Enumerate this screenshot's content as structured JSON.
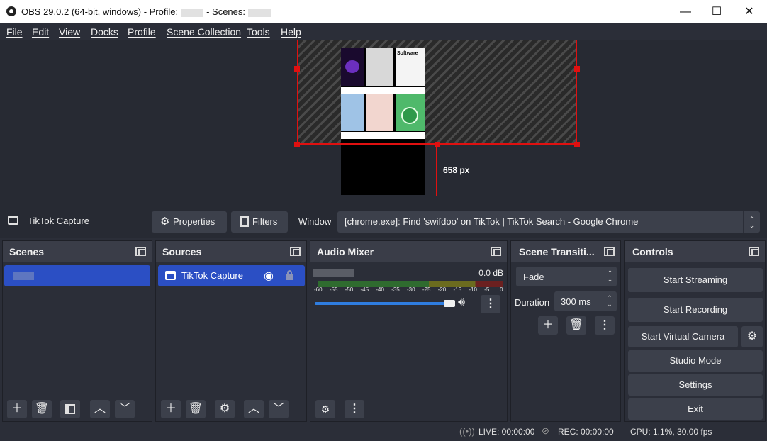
{
  "window": {
    "title_app": "OBS 29.0.2 (64-bit, windows) - Profile:",
    "title_scenes": "- Scenes:",
    "minimize": "—",
    "maximize": "☐",
    "close": "✕"
  },
  "menu": [
    "File",
    "Edit",
    "View",
    "Docks",
    "Profile",
    "Scene Collection",
    "Tools",
    "Help"
  ],
  "preview": {
    "size_label": "658 px",
    "tile_heading": "Software"
  },
  "source_toolbar": {
    "source_name": "TikTok Capture",
    "properties": "Properties",
    "filters": "Filters",
    "window_label": "Window",
    "window_value": "[chrome.exe]: Find 'swifdoo' on TikTok | TikTok Search - Google Chrome"
  },
  "scenes": {
    "title": "Scenes"
  },
  "sources": {
    "title": "Sources",
    "items": [
      {
        "label": "TikTok Capture"
      }
    ]
  },
  "audio_mixer": {
    "title": "Audio Mixer",
    "level": "0.0 dB",
    "ticks": [
      "-60",
      "-55",
      "-50",
      "-45",
      "-40",
      "-35",
      "-30",
      "-25",
      "-20",
      "-15",
      "-10",
      "-5",
      "0"
    ],
    "volume": 1.0
  },
  "transitions": {
    "title": "Scene Transiti...",
    "selected": "Fade",
    "duration_label": "Duration",
    "duration_value": "300 ms"
  },
  "controls": {
    "title": "Controls",
    "start_streaming": "Start Streaming",
    "start_recording": "Start Recording",
    "start_virtual_camera": "Start Virtual Camera",
    "studio_mode": "Studio Mode",
    "settings": "Settings",
    "exit": "Exit"
  },
  "status": {
    "live": "LIVE: 00:00:00",
    "rec": "REC: 00:00:00",
    "cpu": "CPU: 1.1%, 30.00 fps"
  },
  "colors": {
    "accent": "#2b4fc4",
    "selection_red": "#e01010",
    "panel": "#2b2e38",
    "header": "#3a3d48",
    "button": "#3c404b"
  }
}
